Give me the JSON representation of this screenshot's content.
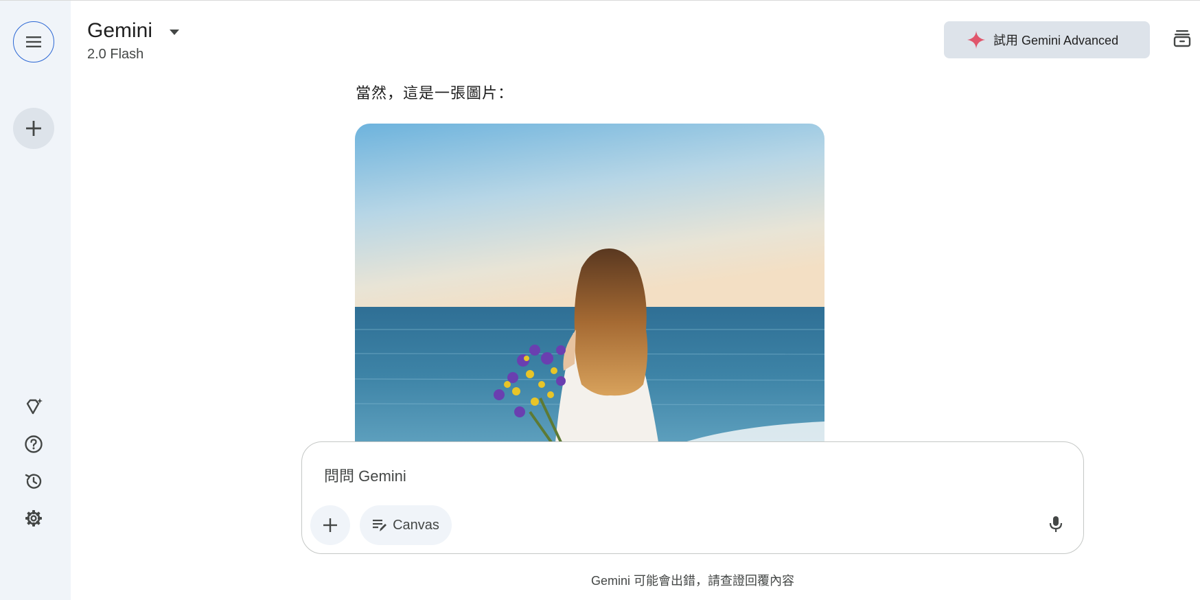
{
  "header": {
    "app_title": "Gemini",
    "model_name": "2.0 Flash",
    "advanced_button_label": "試用 Gemini Advanced"
  },
  "conversation": {
    "response_text": "當然，這是一張圖片："
  },
  "input": {
    "placeholder": "問問 Gemini",
    "canvas_label": "Canvas"
  },
  "footer": {
    "disclaimer": "Gemini 可能會出錯，請查證回覆內容"
  },
  "sidebar": {
    "icons": [
      "menu-icon",
      "new-chat-icon",
      "gem-icon",
      "help-icon",
      "activity-icon",
      "settings-icon"
    ]
  },
  "colors": {
    "sidebar_bg": "#f0f4f9",
    "accent": "#2a66d4",
    "spark": "#e0566c"
  }
}
